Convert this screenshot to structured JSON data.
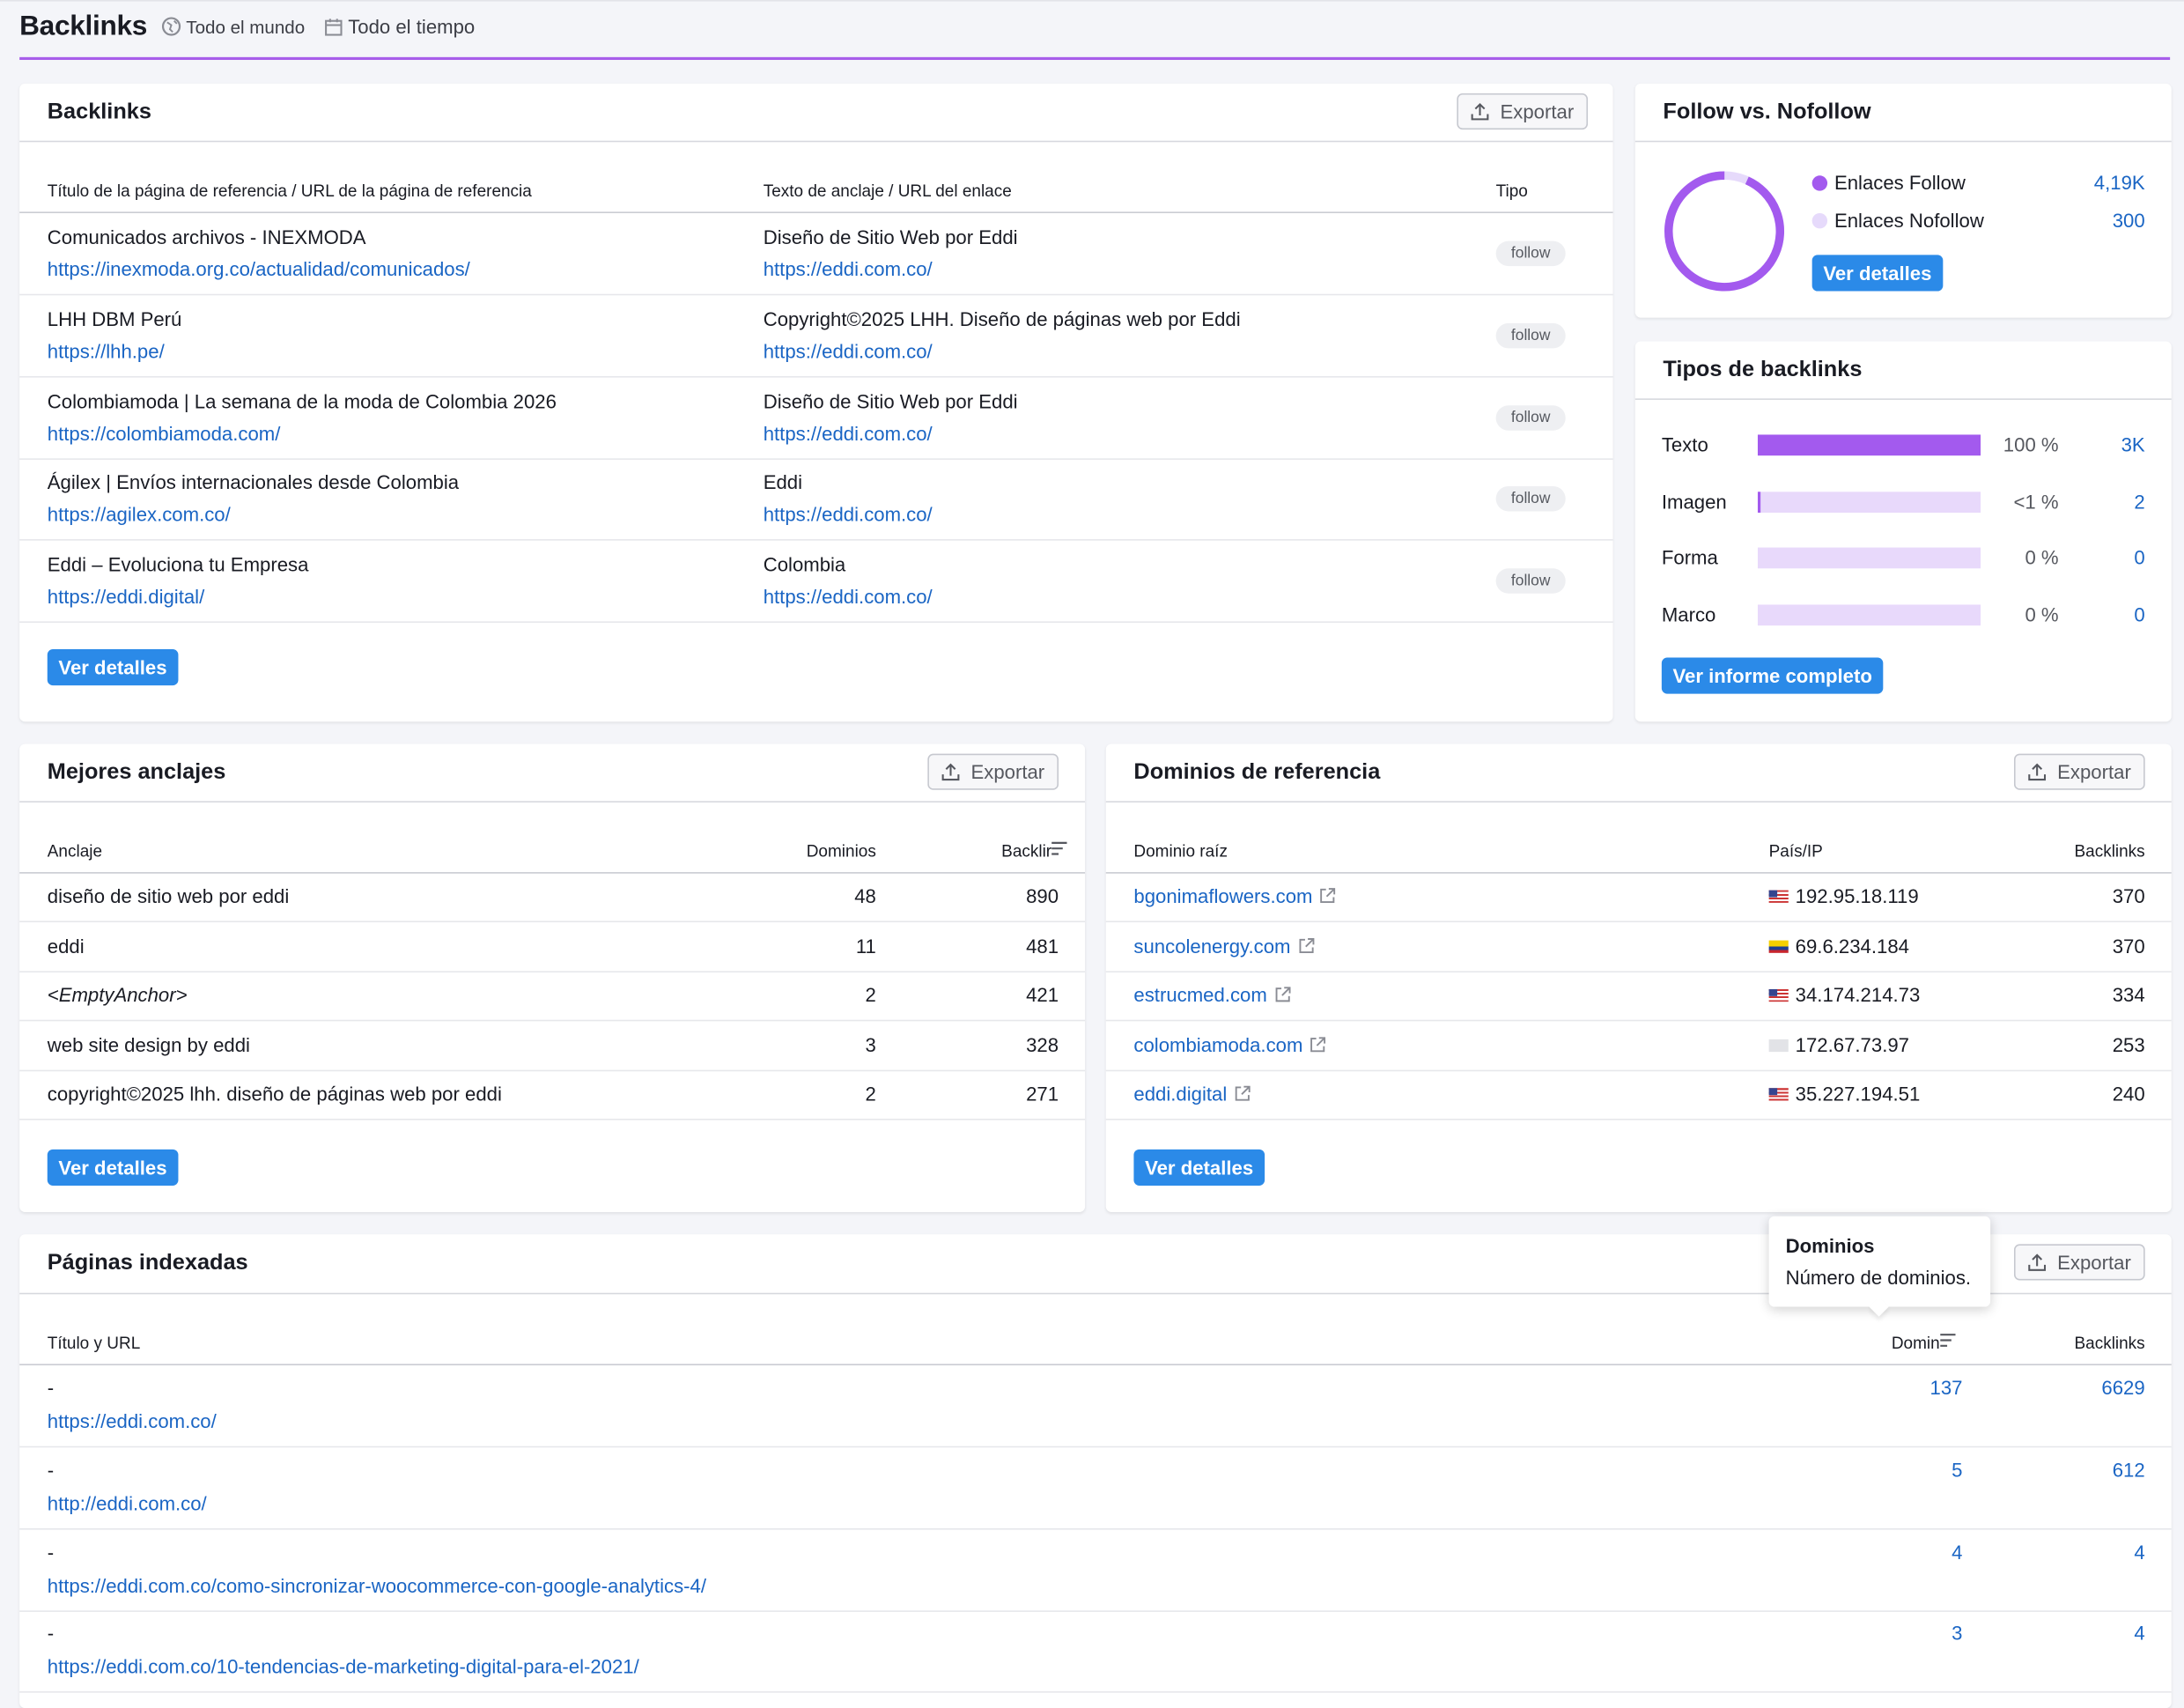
{
  "header": {
    "title": "Backlinks",
    "region": "Todo el mundo",
    "period": "Todo el tiempo"
  },
  "backlinks": {
    "title": "Backlinks",
    "export_label": "Exportar",
    "columns": [
      "Título de la página de referencia / URL de la página de referencia",
      "Texto de anclaje / URL del enlace",
      "Tipo"
    ],
    "rows": [
      {
        "title": "Comunicados archivos - INEXMODA",
        "url": "https://inexmoda.org.co/actualidad/comunicados/",
        "anchor": "Diseño de Sitio Web por Eddi",
        "target": "https://eddi.com.co/",
        "type": "follow"
      },
      {
        "title": "LHH DBM Perú",
        "url": "https://lhh.pe/",
        "anchor": "Copyright©2025 LHH. Diseño de páginas web por Eddi",
        "target": "https://eddi.com.co/",
        "type": "follow"
      },
      {
        "title": "Colombiamoda | La semana de la moda de Colombia 2026",
        "url": "https://colombiamoda.com/",
        "anchor": "Diseño de Sitio Web por Eddi",
        "target": "https://eddi.com.co/",
        "type": "follow"
      },
      {
        "title": "Ágilex | Envíos internacionales desde Colombia",
        "url": "https://agilex.com.co/",
        "anchor": "Eddi",
        "target": "https://eddi.com.co/",
        "type": "follow"
      },
      {
        "title": "Eddi – Evoluciona tu Empresa",
        "url": "https://eddi.digital/",
        "anchor": "Colombia",
        "target": "https://eddi.com.co/",
        "type": "follow"
      }
    ],
    "details_label": "Ver detalles"
  },
  "follow": {
    "title": "Follow vs. Nofollow",
    "items": [
      {
        "label": "Enlaces Follow",
        "value": "4,19K",
        "color": "#a35aee"
      },
      {
        "label": "Enlaces Nofollow",
        "value": "300",
        "color": "#e6dafb"
      }
    ],
    "details_label": "Ver detalles"
  },
  "types": {
    "title": "Tipos de backlinks",
    "rows": [
      {
        "label": "Texto",
        "pct": "100 %",
        "count": "3K",
        "fill": 1.0
      },
      {
        "label": "Imagen",
        "pct": "<1 %",
        "count": "2",
        "fill": 0.01
      },
      {
        "label": "Forma",
        "pct": "0 %",
        "count": "0",
        "fill": 0
      },
      {
        "label": "Marco",
        "pct": "0 %",
        "count": "0",
        "fill": 0
      }
    ],
    "report_label": "Ver informe completo"
  },
  "anchors": {
    "title": "Mejores anclajes",
    "export_label": "Exportar",
    "columns": [
      "Anclaje",
      "Dominios",
      "Backlir"
    ],
    "rows": [
      {
        "anchor": "diseño de sitio web por eddi",
        "domains": "48",
        "backlinks": "890"
      },
      {
        "anchor": "eddi",
        "domains": "11",
        "backlinks": "481"
      },
      {
        "anchor": "<EmptyAnchor>",
        "domains": "2",
        "backlinks": "421"
      },
      {
        "anchor": "web site design by eddi",
        "domains": "3",
        "backlinks": "328"
      },
      {
        "anchor": "copyright©2025 lhh. diseño de páginas web por eddi",
        "domains": "2",
        "backlinks": "271"
      }
    ],
    "details_label": "Ver detalles"
  },
  "domains": {
    "title": "Dominios de referencia",
    "export_label": "Exportar",
    "columns": [
      "Dominio raíz",
      "País/IP",
      "Backlinks"
    ],
    "rows": [
      {
        "domain": "bgonimaflowers.com",
        "ip": "192.95.18.119",
        "flag": "us",
        "backlinks": "370"
      },
      {
        "domain": "suncolenergy.com",
        "ip": "69.6.234.184",
        "flag": "co",
        "backlinks": "370"
      },
      {
        "domain": "estrucmed.com",
        "ip": "34.174.214.73",
        "flag": "us",
        "backlinks": "334"
      },
      {
        "domain": "colombiamoda.com",
        "ip": "172.67.73.97",
        "flag": "none",
        "backlinks": "253"
      },
      {
        "domain": "eddi.digital",
        "ip": "35.227.194.51",
        "flag": "us",
        "backlinks": "240"
      }
    ],
    "details_label": "Ver detalles"
  },
  "indexed": {
    "title": "Páginas indexadas",
    "export_label": "Exportar",
    "columns": [
      "Título y URL",
      "Domin",
      "Backlinks"
    ],
    "rows": [
      {
        "title": "-",
        "url": "https://eddi.com.co/",
        "domains": "137",
        "backlinks": "6629"
      },
      {
        "title": "-",
        "url": "http://eddi.com.co/",
        "domains": "5",
        "backlinks": "612"
      },
      {
        "title": "-",
        "url": "https://eddi.com.co/como-sincronizar-woocommerce-con-google-analytics-4/",
        "domains": "4",
        "backlinks": "4"
      },
      {
        "title": "-",
        "url": "https://eddi.com.co/10-tendencias-de-marketing-digital-para-el-2021/",
        "domains": "3",
        "backlinks": "4"
      }
    ]
  },
  "tooltip": {
    "title": "Dominios",
    "text": "Número de dominios."
  }
}
